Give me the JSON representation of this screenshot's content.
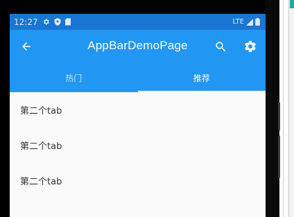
{
  "status_bar": {
    "time": "12:27",
    "network": "LTE"
  },
  "app_bar": {
    "title": "AppBarDemoPage",
    "back_icon": "arrow-back-icon",
    "search_icon": "search-icon",
    "settings_icon": "gear-icon"
  },
  "tabs": [
    {
      "label": "热门",
      "selected": false
    },
    {
      "label": "推荐",
      "selected": true
    }
  ],
  "list": {
    "items": [
      "第二个tab",
      "第二个tab",
      "第二个tab"
    ]
  },
  "colors": {
    "app_bar": "#2196f3",
    "status_bar": "#1976d2",
    "background": "#fafafa"
  }
}
